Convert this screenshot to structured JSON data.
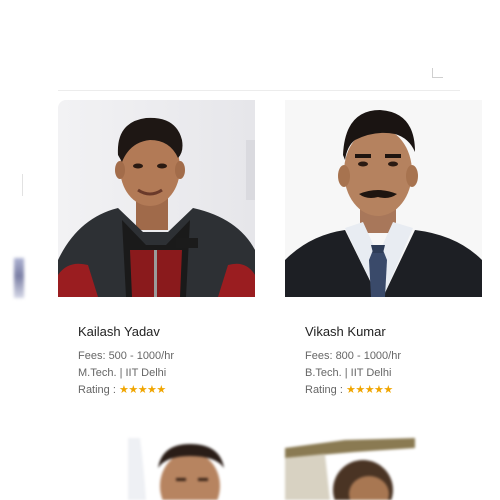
{
  "profiles": [
    {
      "name": "Kailash Yadav",
      "fees": "Fees: 500 - 1000/hr",
      "qualification": "M.Tech. | IIT Delhi",
      "rating_label": "Rating : ",
      "rating_stars": "★★★★★",
      "rating_value": 5,
      "rating_max": 5
    },
    {
      "name": "Vikash Kumar",
      "fees": "Fees: 800 - 1000/hr",
      "qualification": "B.Tech. | IIT Delhi",
      "rating_label": "Rating : ",
      "rating_stars": "★★★★★",
      "rating_value": 5,
      "rating_max": 5
    }
  ],
  "colors": {
    "star": "#f0a500",
    "name_text": "#222222",
    "meta_text": "#666666"
  },
  "icons": {
    "rating": "star-icon"
  }
}
